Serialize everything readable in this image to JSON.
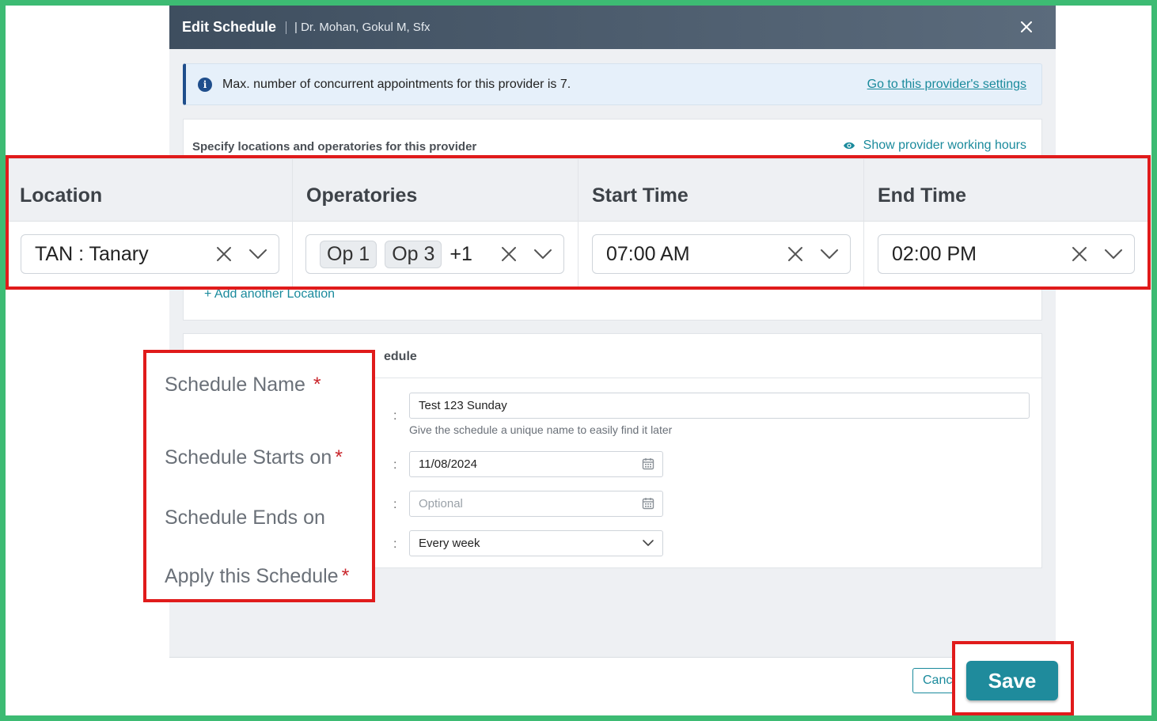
{
  "modal": {
    "title": "Edit Schedule",
    "subtitle": "| Dr. Mohan, Gokul M, Sfx"
  },
  "info": {
    "message": "Max. number of concurrent appointments for this provider is 7.",
    "link": "Go to this provider's settings"
  },
  "locations_section": {
    "title": "Specify locations and operatories for this provider",
    "show_hours_link": "Show provider working hours",
    "add_location_link": "+ Add another Location",
    "columns": [
      "Location",
      "Operatories",
      "Start Time",
      "End Time"
    ],
    "row": {
      "location": "TAN : Tanary",
      "operatory_chips": [
        "Op 1",
        "Op 3"
      ],
      "operatory_more": "+1",
      "start_time": "07:00 AM",
      "end_time": "02:00 PM"
    }
  },
  "schedule_section": {
    "title_visible": "edule",
    "labels": {
      "name": "Schedule Name",
      "starts_on": "Schedule Starts on",
      "ends_on": "Schedule Ends on",
      "apply": "Apply this Schedule"
    },
    "required_mark": "*",
    "colon": ":",
    "name_value": "Test 123 Sunday",
    "name_helper": "Give the schedule a unique name to easily find it later",
    "starts_value": "11/08/2024",
    "ends_placeholder": "Optional",
    "apply_value": "Every week"
  },
  "footer": {
    "cancel_label": "Canc",
    "save_label": "Save"
  },
  "colors": {
    "accent": "#1a8a9c",
    "header_bg": "#3e4e5f",
    "highlight_border": "#e01b1b",
    "frame": "#3dbb73",
    "required": "#c9262c"
  }
}
